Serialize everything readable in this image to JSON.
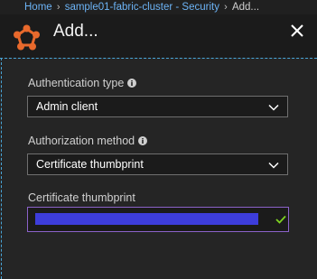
{
  "breadcrumb": {
    "items": [
      "Home",
      "sample01-fabric-cluster - Security",
      "Add..."
    ]
  },
  "header": {
    "title": "Add...",
    "logo_icon": "service-fabric-logo-icon",
    "close_icon": "close-icon"
  },
  "form": {
    "auth_type": {
      "label": "Authentication type",
      "value": "Admin client"
    },
    "authorization": {
      "label": "Authorization method",
      "value": "Certificate thumbprint"
    },
    "thumbprint": {
      "label": "Certificate thumbprint",
      "value_redacted": true
    }
  },
  "colors": {
    "accent_blue": "#6cb3f5",
    "brand_orange": "#e8692c",
    "input_focus": "#8b62c9",
    "redaction": "#3d3ddb",
    "valid_check": "#7ed321"
  }
}
